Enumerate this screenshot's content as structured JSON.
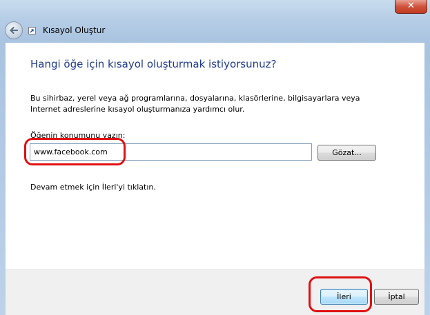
{
  "window": {
    "title": "Kısayol Oluştur",
    "close_label": "✕"
  },
  "wizard": {
    "heading": "Hangi öğe için kısayol oluşturmak istiyorsunuz?",
    "description": "Bu sihirbaz, yerel veya ağ programlarına, dosyalarına, klasörlerine, bilgisayarlara veya Internet adreslerine kısayol oluşturmanıza yardımcı olur.",
    "location_label": "Öğenin konumunu yazın:",
    "location_value": "www.facebook.com",
    "browse_label": "Gözat...",
    "hint": "Devam etmek için İleri'yi tıklatın."
  },
  "footer": {
    "next_label": "İleri",
    "cancel_label": "İptal"
  },
  "colors": {
    "heading": "#1e3a8c",
    "annotation": "#e01010"
  },
  "icons": [
    "close-icon",
    "back-arrow-icon",
    "shortcut-icon"
  ]
}
